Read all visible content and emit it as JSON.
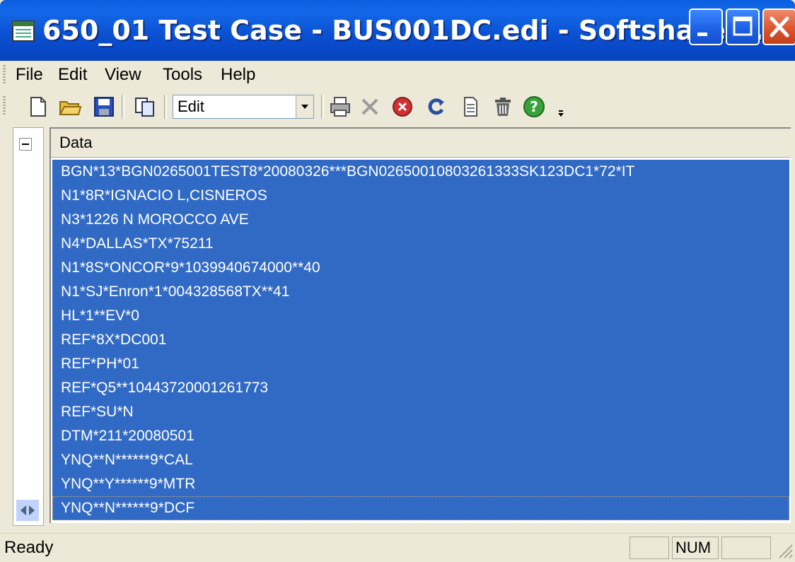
{
  "window": {
    "title": "650_01 Test Case - BUS001DC.edi - Softshare E..."
  },
  "menu": {
    "items": [
      "File",
      "Edit",
      "View",
      "Tools",
      "Help"
    ]
  },
  "toolbar": {
    "mode_value": "Edit"
  },
  "grid": {
    "column_header": "Data",
    "rows": [
      "BGN*13*BGN0265001TEST8*20080326***BGN02650010803261333SK123DC1*72*IT",
      "N1*8R*IGNACIO L,CISNEROS",
      "N3*1226 N MOROCCO AVE",
      "N4*DALLAS*TX*75211",
      "N1*8S*ONCOR*9*1039940674000**40",
      "N1*SJ*Enron*1*004328568TX**41",
      "HL*1**EV*0",
      "REF*8X*DC001",
      "REF*PH*01",
      "REF*Q5**10443720001261773",
      "REF*SU*N",
      "DTM*211*20080501",
      "YNQ**N******9*CAL",
      "YNQ**Y******9*MTR",
      "YNQ**N******9*DCF"
    ]
  },
  "status": {
    "text": "Ready",
    "num": "NUM"
  },
  "colors": {
    "selection": "#316ac5",
    "titlebar": "#0a4fd0"
  }
}
